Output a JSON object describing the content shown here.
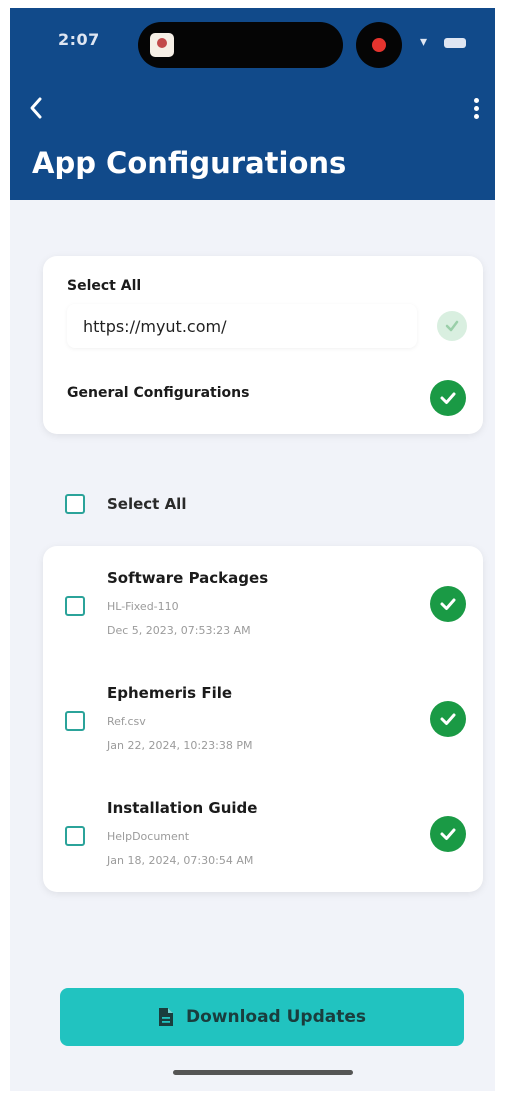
{
  "status_bar": {
    "time": "2:07"
  },
  "header": {
    "title": "App Configurations",
    "back_icon": "chevron-left-icon",
    "menu_icon": "more-vertical-icon",
    "background": "#114a8a"
  },
  "config_card": {
    "select_all_label": "Select All",
    "url_value": "https://myut.com/",
    "general_label": "General Configurations"
  },
  "select_all": {
    "label": "Select All"
  },
  "items": [
    {
      "title": "Software Packages",
      "subtitle": "HL-Fixed-110",
      "date": "Dec 5, 2023, 07:53:23 AM"
    },
    {
      "title": "Ephemeris File",
      "subtitle": "Ref.csv",
      "date": "Jan 22, 2024, 10:23:38 PM"
    },
    {
      "title": "Installation Guide",
      "subtitle": "HelpDocument",
      "date": "Jan 18, 2024, 07:30:54 AM"
    }
  ],
  "download_button": {
    "label": "Download Updates",
    "icon": "file-icon",
    "color": "#21c3c0"
  },
  "colors": {
    "accent_green": "#1a9a45",
    "checkbox_border": "#2ba39a",
    "background": "#f1f3f9"
  }
}
